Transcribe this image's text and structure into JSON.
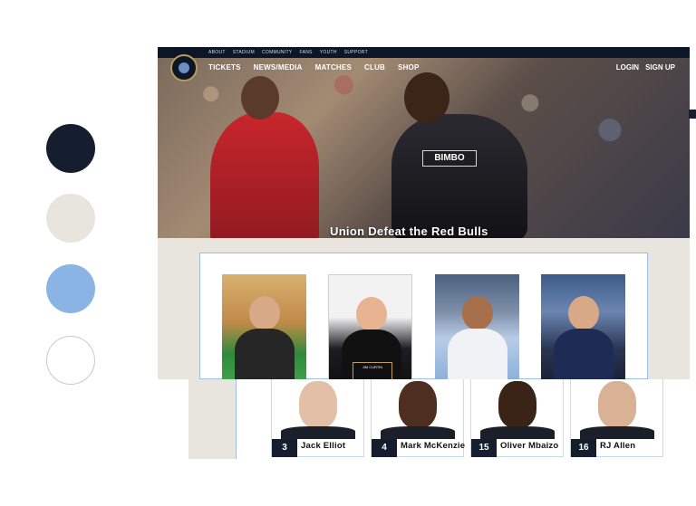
{
  "palette": {
    "swatches": [
      "#141e2f",
      "#e8e5df",
      "#8ab4e4",
      "#ffffff"
    ]
  },
  "site": {
    "utility_nav": [
      "ABOUT",
      "STADIUM",
      "COMMUNITY",
      "FANS",
      "YOUTH",
      "SUPPORT"
    ],
    "main_nav": [
      "TICKETS",
      "NEWS/MEDIA",
      "MATCHES",
      "CLUB",
      "SHOP"
    ],
    "auth": {
      "login": "LOGIN",
      "signup": "SIGN UP"
    },
    "hero": {
      "headline": "Union Defeat the Red Bulls",
      "sponsor": "BIMBO"
    },
    "gallery": {
      "podium_text": "JIM CURTIN"
    }
  },
  "roster": [
    {
      "number": "3",
      "name": "Jack  Elliot"
    },
    {
      "number": "4",
      "name": "Mark  McKenzie"
    },
    {
      "number": "15",
      "name": "Oliver  Mbaizo"
    },
    {
      "number": "16",
      "name": "RJ  Allen"
    }
  ]
}
